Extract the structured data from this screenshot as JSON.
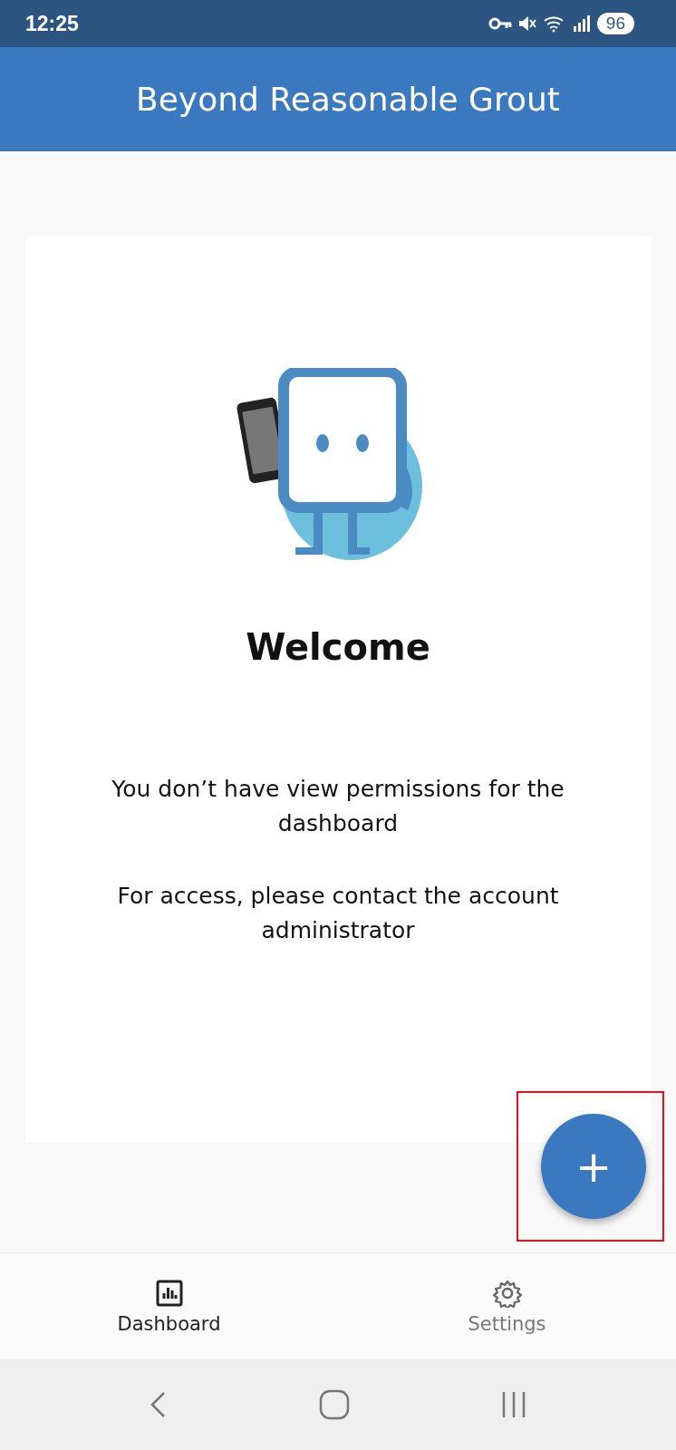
{
  "status_bar": {
    "time": "12:25",
    "battery": "96"
  },
  "app_bar": {
    "title": "Beyond Reasonable Grout"
  },
  "welcome": {
    "heading": "Welcome",
    "paragraphs": [
      "You don’t have view permissions for the dashboard",
      "For access, please contact the account administrator"
    ]
  },
  "fab": {
    "label": "+",
    "highlighted": true
  },
  "bottom_nav": [
    {
      "label": "Dashboard",
      "kind": "chart",
      "selected": true
    },
    {
      "label": "Settings",
      "kind": "gear",
      "selected": false
    }
  ]
}
